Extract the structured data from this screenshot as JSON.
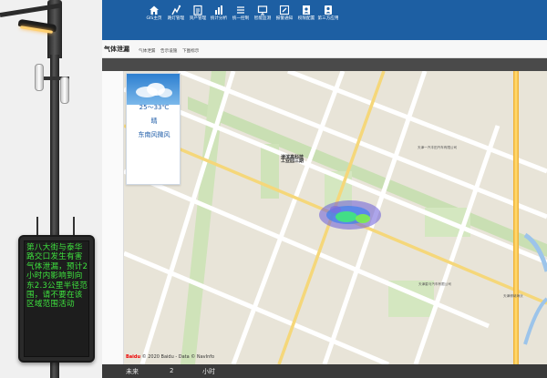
{
  "nav": {
    "items": [
      {
        "label": "GIS主页",
        "icon": "home-icon"
      },
      {
        "label": "路灯管理",
        "icon": "streetlight-icon"
      },
      {
        "label": "资产管理",
        "icon": "asset-icon"
      },
      {
        "label": "统计分析",
        "icon": "bar-chart-icon"
      },
      {
        "label": "统一控制",
        "icon": "list-icon"
      },
      {
        "label": "智能监测",
        "icon": "monitor-icon"
      },
      {
        "label": "报警通知",
        "icon": "edit-icon"
      },
      {
        "label": "权限配置",
        "icon": "user-doc-icon"
      },
      {
        "label": "第三方应用",
        "icon": "person-icon"
      }
    ]
  },
  "subbar": {
    "title": "气体泄漏",
    "tabs": [
      "气体泄漏",
      "告示设施",
      "下图标示"
    ]
  },
  "weather": {
    "temp": "25～33℃",
    "condition": "晴",
    "wind": "东南风微风"
  },
  "map": {
    "district_label": "津滨高科技\n工业园三期",
    "places": [
      "天津一汽丰田汽车有限公司",
      "天津星马汽车有限公司",
      "天津博纳海沃"
    ]
  },
  "led": {
    "message": "第八大街与泰华路交口发生有害气体泄漏，预计2小时内影响到向东2.3公里半径范围，请不要在该区域范围活动"
  },
  "bottom": {
    "left": "未来",
    "mid": "2",
    "right": "小时"
  },
  "footer": {
    "baidu": "Baidu",
    "copyright": "© 2020 Baidu - Data © NavInfo"
  },
  "colors": {
    "nav_bg": "#1d5fa3",
    "led_text": "#3ee23e",
    "weather_text": "#1a59a6"
  }
}
